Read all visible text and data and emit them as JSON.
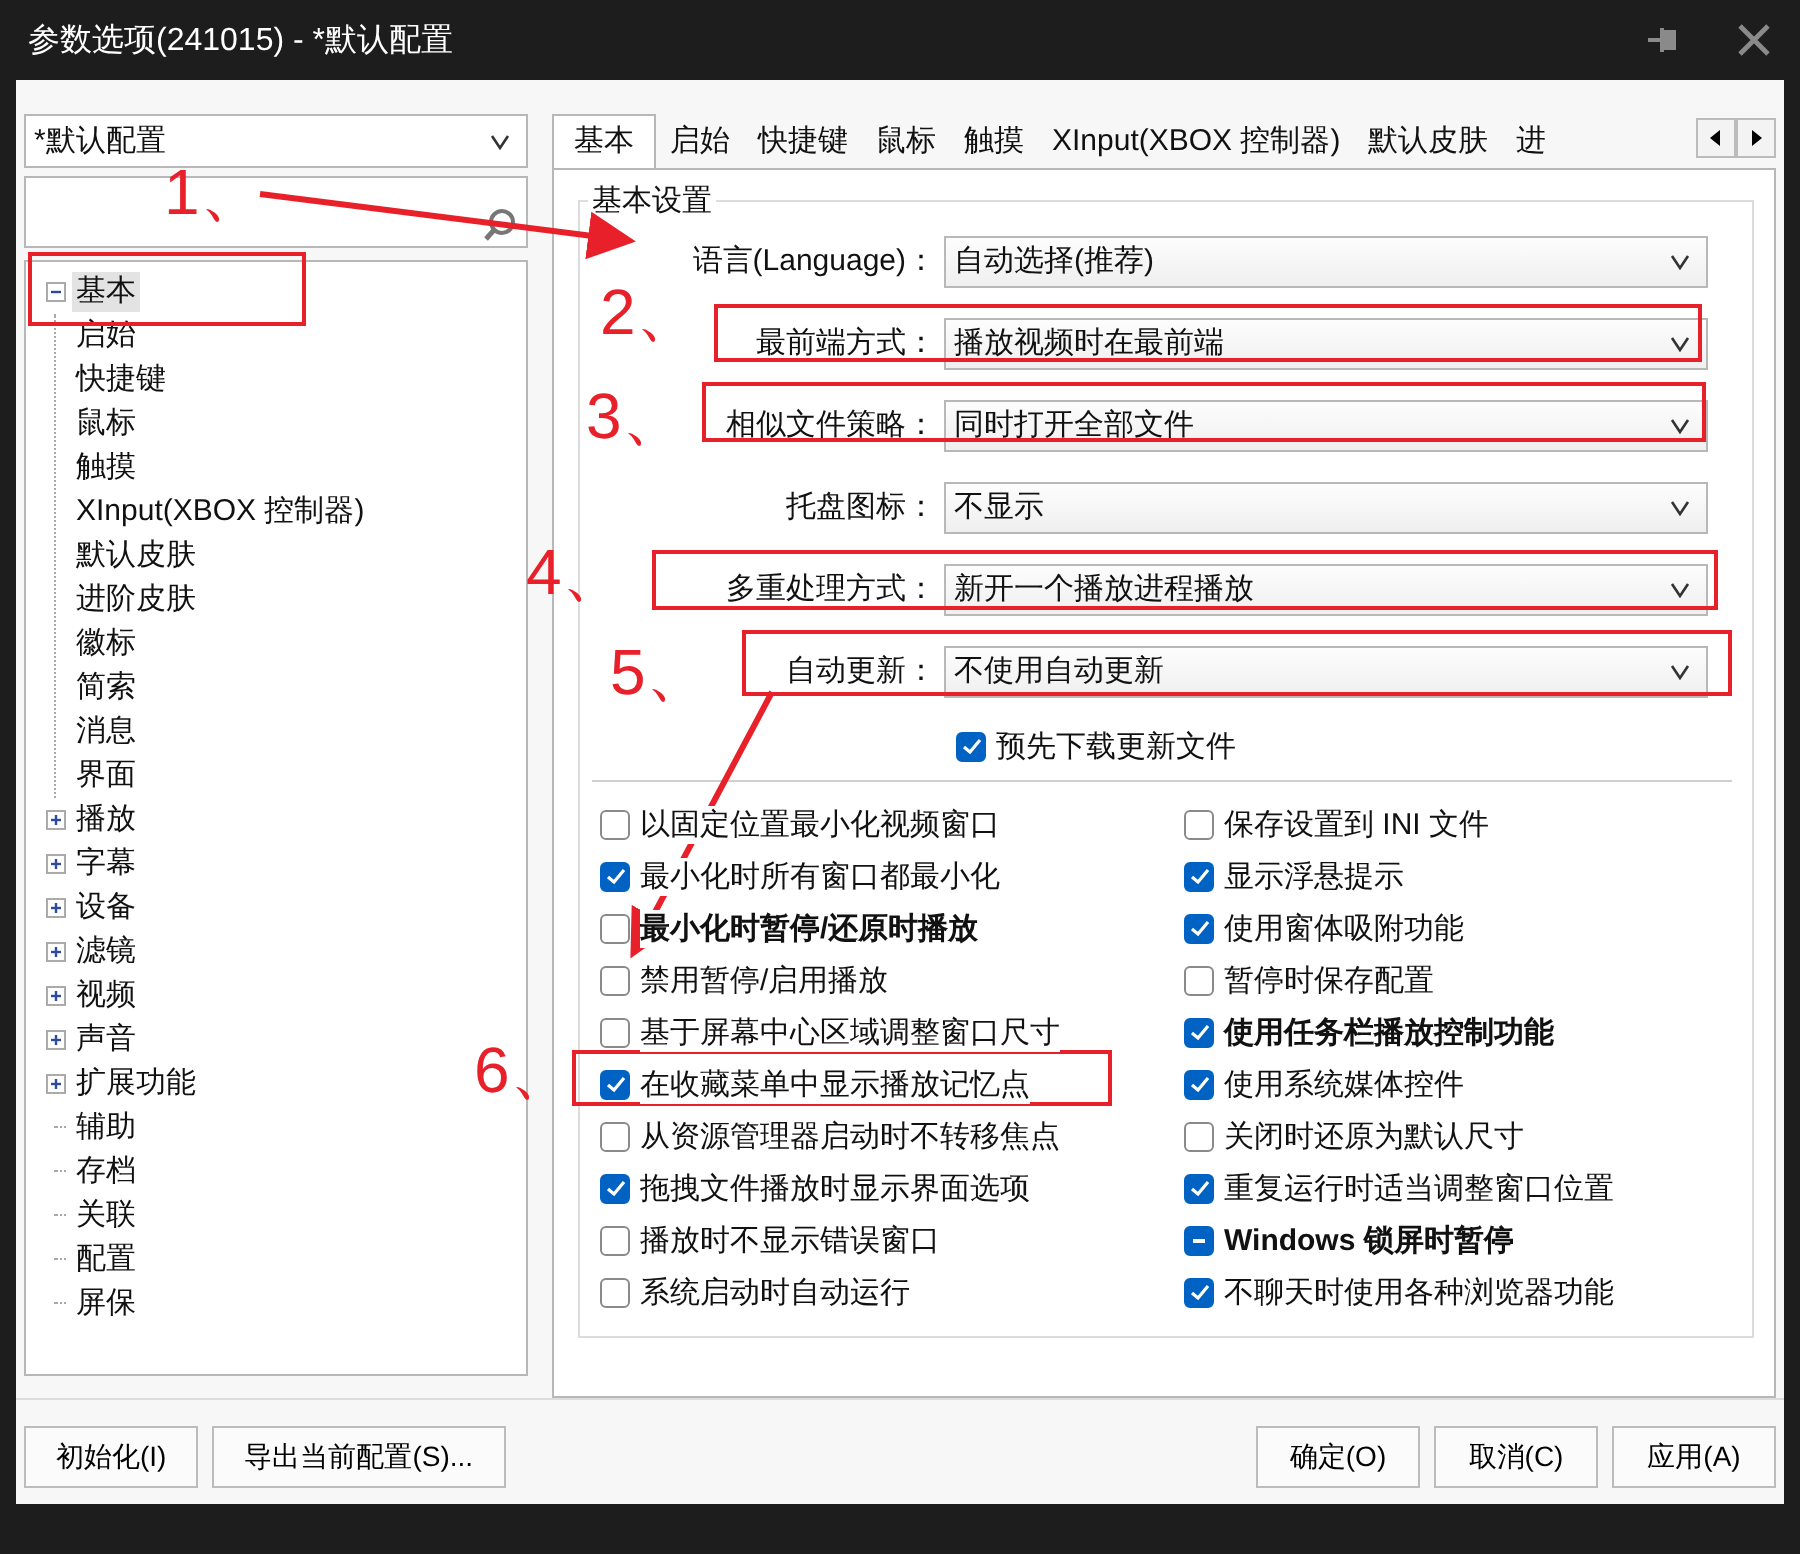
{
  "window": {
    "title": "参数选项(241015) - *默认配置"
  },
  "profile": {
    "value": "*默认配置"
  },
  "tree": [
    {
      "label": "基本",
      "selected": true,
      "expanded": true,
      "children": [
        {
          "label": "启始",
          "selected": false
        },
        {
          "label": "快捷键",
          "selected": false
        },
        {
          "label": "鼠标",
          "selected": false
        },
        {
          "label": "触摸",
          "selected": false
        },
        {
          "label": "XInput(XBOX 控制器)",
          "selected": false
        },
        {
          "label": "默认皮肤",
          "selected": false
        },
        {
          "label": "进阶皮肤",
          "selected": false
        },
        {
          "label": "徽标",
          "selected": false
        },
        {
          "label": "简索",
          "selected": false
        },
        {
          "label": "消息",
          "selected": false
        },
        {
          "label": "界面",
          "selected": false
        }
      ]
    },
    {
      "label": "播放",
      "selected": false,
      "expanded": false
    },
    {
      "label": "字幕",
      "selected": false,
      "expanded": false
    },
    {
      "label": "设备",
      "selected": false,
      "expanded": false
    },
    {
      "label": "滤镜",
      "selected": false,
      "expanded": false
    },
    {
      "label": "视频",
      "selected": false,
      "expanded": false
    },
    {
      "label": "声音",
      "selected": false,
      "expanded": false
    },
    {
      "label": "扩展功能",
      "selected": false,
      "expanded": false
    },
    {
      "label": "辅助",
      "selected": false
    },
    {
      "label": "存档",
      "selected": false
    },
    {
      "label": "关联",
      "selected": false
    },
    {
      "label": "配置",
      "selected": false
    },
    {
      "label": "屏保",
      "selected": false
    }
  ],
  "tabs": [
    {
      "label": "基本",
      "selected": true
    },
    {
      "label": "启始",
      "selected": false
    },
    {
      "label": "快捷键",
      "selected": false
    },
    {
      "label": "鼠标",
      "selected": false
    },
    {
      "label": "触摸",
      "selected": false
    },
    {
      "label": "XInput(XBOX 控制器)",
      "selected": false
    },
    {
      "label": "默认皮肤",
      "selected": false
    },
    {
      "label": "进",
      "selected": false
    }
  ],
  "group": {
    "title": "基本设置",
    "settings": [
      {
        "label": "语言(Language)：",
        "value": "自动选择(推荐)"
      },
      {
        "label": "最前端方式：",
        "value": "播放视频时在最前端"
      },
      {
        "label": "相似文件策略：",
        "value": "同时打开全部文件"
      },
      {
        "label": "托盘图标：",
        "value": "不显示"
      },
      {
        "label": "多重处理方式：",
        "value": "新开一个播放进程播放"
      },
      {
        "label": "自动更新：",
        "value": "不使用自动更新"
      }
    ],
    "update_option": {
      "label": "预先下载更新文件",
      "checked": true
    }
  },
  "options": [
    {
      "label": "以固定位置最小化视频窗口",
      "checked": false,
      "mixed": false,
      "bold": false
    },
    {
      "label": "保存设置到 INI 文件",
      "checked": false,
      "mixed": false,
      "bold": false
    },
    {
      "label": "最小化时所有窗口都最小化",
      "checked": true,
      "mixed": false,
      "bold": false
    },
    {
      "label": "显示浮悬提示",
      "checked": true,
      "mixed": false,
      "bold": false
    },
    {
      "label": "最小化时暂停/还原时播放",
      "checked": false,
      "mixed": false,
      "bold": true
    },
    {
      "label": "使用窗体吸附功能",
      "checked": true,
      "mixed": false,
      "bold": false
    },
    {
      "label": "禁用暂停/启用播放",
      "checked": false,
      "mixed": false,
      "bold": false
    },
    {
      "label": "暂停时保存配置",
      "checked": false,
      "mixed": false,
      "bold": false
    },
    {
      "label": "基于屏幕中心区域调整窗口尺寸",
      "checked": false,
      "mixed": false,
      "bold": false
    },
    {
      "label": "使用任务栏播放控制功能",
      "checked": true,
      "mixed": false,
      "bold": true
    },
    {
      "label": "在收藏菜单中显示播放记忆点",
      "checked": true,
      "mixed": false,
      "bold": false
    },
    {
      "label": "使用系统媒体控件",
      "checked": true,
      "mixed": false,
      "bold": false
    },
    {
      "label": "从资源管理器启动时不转移焦点",
      "checked": false,
      "mixed": false,
      "bold": false
    },
    {
      "label": "关闭时还原为默认尺寸",
      "checked": false,
      "mixed": false,
      "bold": false
    },
    {
      "label": "拖拽文件播放时显示界面选项",
      "checked": true,
      "mixed": false,
      "bold": false
    },
    {
      "label": "重复运行时适当调整窗口位置",
      "checked": true,
      "mixed": false,
      "bold": false
    },
    {
      "label": "播放时不显示错误窗口",
      "checked": false,
      "mixed": false,
      "bold": false
    },
    {
      "label": "Windows 锁屏时暂停",
      "checked": true,
      "mixed": true,
      "bold": true
    },
    {
      "label": "系统启动时自动运行",
      "checked": false,
      "mixed": false,
      "bold": false
    },
    {
      "label": "不聊天时使用各种浏览器功能",
      "checked": true,
      "mixed": false,
      "bold": false
    }
  ],
  "buttons_left": [
    "初始化(I)",
    "导出当前配置(S)..."
  ],
  "buttons_right": [
    "确定(O)",
    "取消(C)",
    "应用(A)"
  ],
  "annotations": [
    {
      "label": "1、"
    },
    {
      "label": "2、"
    },
    {
      "label": "3、"
    },
    {
      "label": "4、"
    },
    {
      "label": "5、"
    },
    {
      "label": "6、"
    }
  ]
}
